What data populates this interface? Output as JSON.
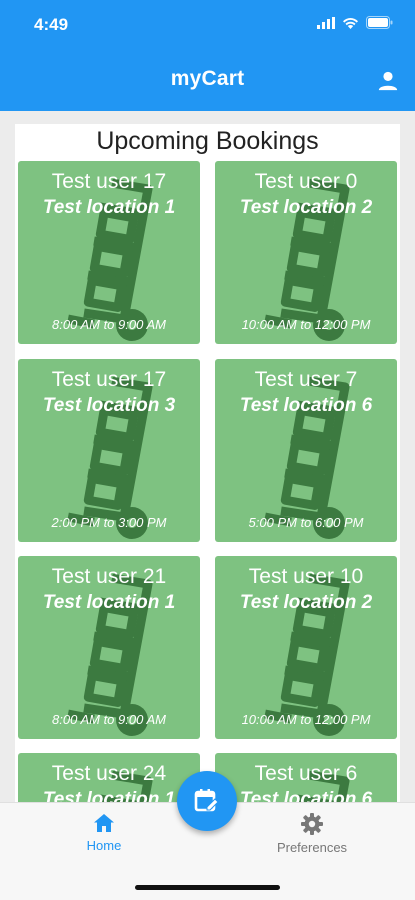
{
  "status": {
    "time": "4:49"
  },
  "app": {
    "title": "myCart"
  },
  "section": {
    "title": "Upcoming Bookings"
  },
  "bookings": [
    {
      "user": "Test user 17",
      "location": "Test location 1",
      "time": "8:00 AM to 9:00 AM"
    },
    {
      "user": "Test user 0",
      "location": "Test location 2",
      "time": "10:00 AM to 12:00 PM"
    },
    {
      "user": "Test user 17",
      "location": "Test location 3",
      "time": "2:00 PM to 3:00 PM"
    },
    {
      "user": "Test user 7",
      "location": "Test location 6",
      "time": "5:00 PM to 6:00 PM"
    },
    {
      "user": "Test user 21",
      "location": "Test location 1",
      "time": "8:00 AM to 9:00 AM"
    },
    {
      "user": "Test user 10",
      "location": "Test location 2",
      "time": "10:00 AM to 12:00 PM"
    },
    {
      "user": "Test user 24",
      "location": "Test location 1",
      "time": ""
    },
    {
      "user": "Test user 6",
      "location": "Test location 6",
      "time": ""
    }
  ],
  "nav": {
    "home_label": "Home",
    "prefs_label": "Preferences"
  },
  "colors": {
    "primary": "#2196f3",
    "card": "#7ec281",
    "cart_icon": "#3c7a40"
  },
  "icons": {
    "cart": "hand-truck-icon",
    "fab": "calendar-edit-icon",
    "profile": "person-icon"
  }
}
